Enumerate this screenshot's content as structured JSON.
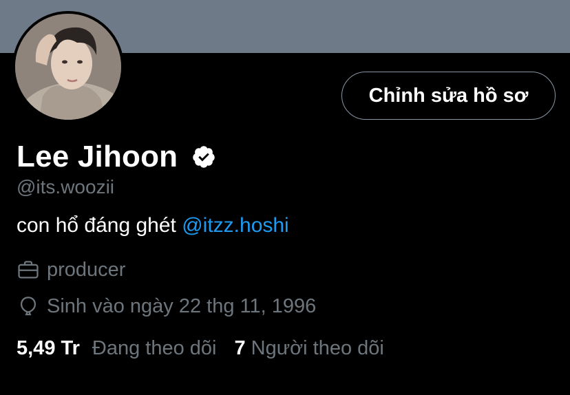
{
  "colors": {
    "banner": "#6e7a88",
    "background": "#000000",
    "text_primary": "#ffffff",
    "text_secondary": "#6e767d",
    "link": "#1d9bf0",
    "button_border": "#8b98a5"
  },
  "profile": {
    "display_name": "Lee Jihoon",
    "verified_icon": "verified-badge-icon",
    "handle": "@its.woozii",
    "bio_text": "con hổ đáng ghét ",
    "bio_mention": "@itzz.hoshi",
    "edit_button_label": "Chỉnh sửa hồ sơ",
    "avatar_icon": "profile-photo"
  },
  "meta": {
    "job_icon": "briefcase-icon",
    "job": "producer",
    "birth_icon": "balloon-icon",
    "birth": "Sinh vào ngày 22 thg 11, 1996"
  },
  "stats": {
    "following_count": "5,49 Tr",
    "following_label": "Đang theo dõi",
    "followers_count": "7",
    "followers_label": "Người theo dõi"
  }
}
